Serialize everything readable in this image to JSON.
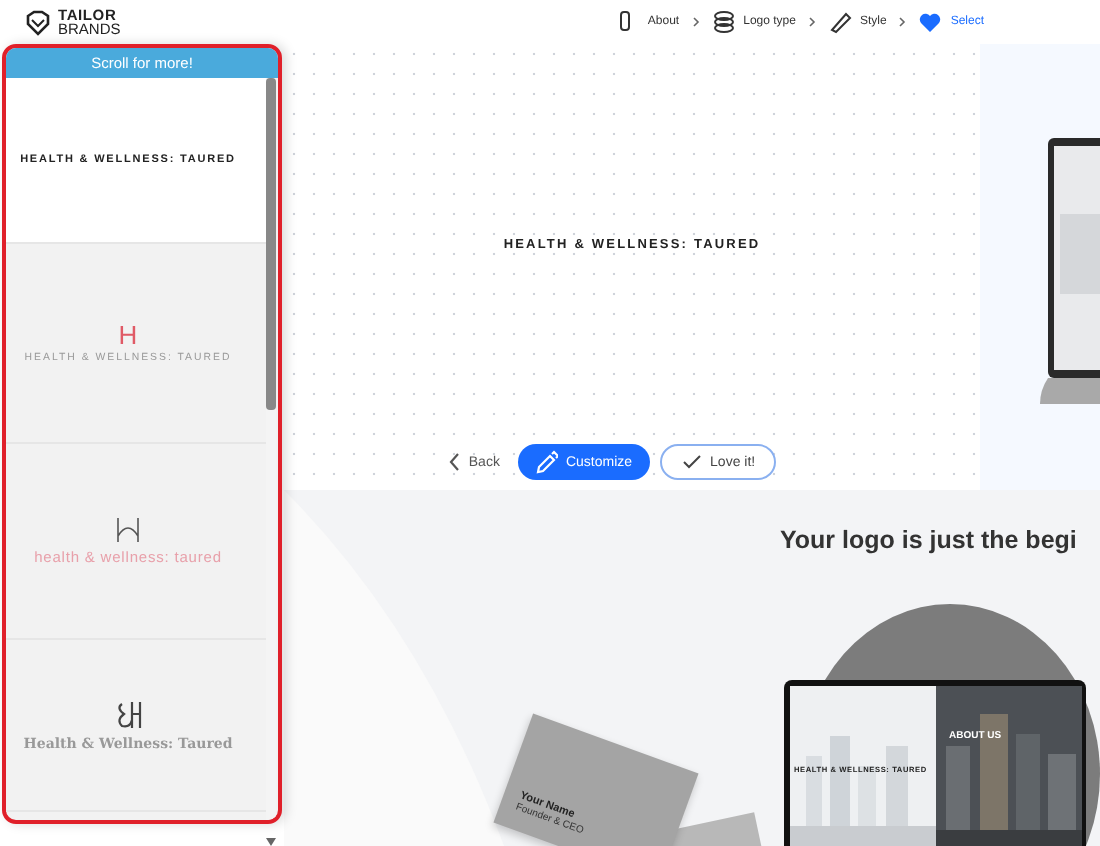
{
  "header": {
    "logo_lines": [
      "TAILOR",
      "BRANDS"
    ],
    "steps": [
      {
        "label": "About",
        "kind": "about",
        "selected": false
      },
      {
        "label": "Logo type",
        "kind": "type",
        "selected": false
      },
      {
        "label": "Style",
        "kind": "style",
        "selected": false
      },
      {
        "label": "Select",
        "kind": "select",
        "selected": true
      }
    ]
  },
  "sidebar": {
    "banner": "Scroll for more!",
    "logos": [
      {
        "text": "HEALTH & WELLNESS: TAURED",
        "kind": "plain",
        "selected": true
      },
      {
        "text": "HEALTH & WELLNESS: TAURED",
        "kind": "letter",
        "mark": "H",
        "selected": false
      },
      {
        "text": "health & wellness: taured",
        "kind": "line",
        "selected": false
      },
      {
        "text": "Health & Wellness: Taured",
        "kind": "script",
        "selected": false
      }
    ]
  },
  "preview": {
    "logo_text": "HEALTH & WELLNESS: TAURED",
    "buttons": [
      {
        "label": "Back",
        "kind": "back"
      },
      {
        "label": "Customize",
        "kind": "primary"
      },
      {
        "label": "Love it!",
        "kind": "outline"
      }
    ]
  },
  "promo": {
    "heading": "Your logo is just the begi",
    "card": {
      "name": "Your Name",
      "title": "Founder & CEO"
    },
    "laptop": {
      "logo_text": "HEALTH & WELLNESS: TAURED",
      "section_title": "ABOUT US"
    }
  }
}
